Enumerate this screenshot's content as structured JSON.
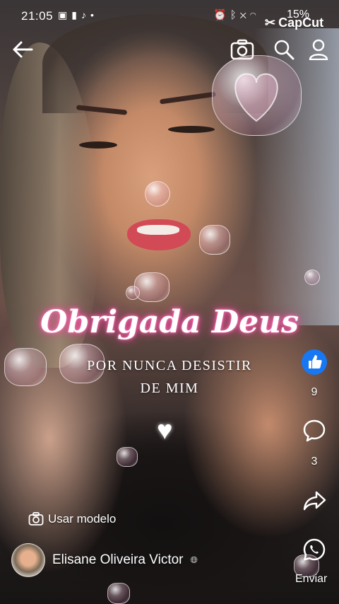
{
  "status_bar": {
    "time": "21:05",
    "battery": "15%",
    "left_icons": [
      "image-icon",
      "battery-saver-icon",
      "tiktok-icon",
      "dot-icon"
    ],
    "right_icons": [
      "alarm-icon",
      "bluetooth-icon",
      "mute-icon",
      "wifi-icon"
    ]
  },
  "watermark": {
    "label": "CapCut"
  },
  "nav": {
    "back_icon": "back-arrow-icon",
    "camera_icon": "camera-icon",
    "search_icon": "search-icon",
    "profile_icon": "profile-icon"
  },
  "overlay": {
    "headline": "Obrigada Deus",
    "line1": "POR NUNCA DESISTIR",
    "line2": "DE MIM",
    "center_heart": "♥"
  },
  "actions": {
    "like_count": "9",
    "comment_count": "3",
    "share_label": "Enviar"
  },
  "template": {
    "label": "Usar modelo"
  },
  "author": {
    "name": "Elisane Oliveira Victor"
  },
  "colors": {
    "like_blue": "#1877f2",
    "glow_pink": "#ff3fa0"
  }
}
